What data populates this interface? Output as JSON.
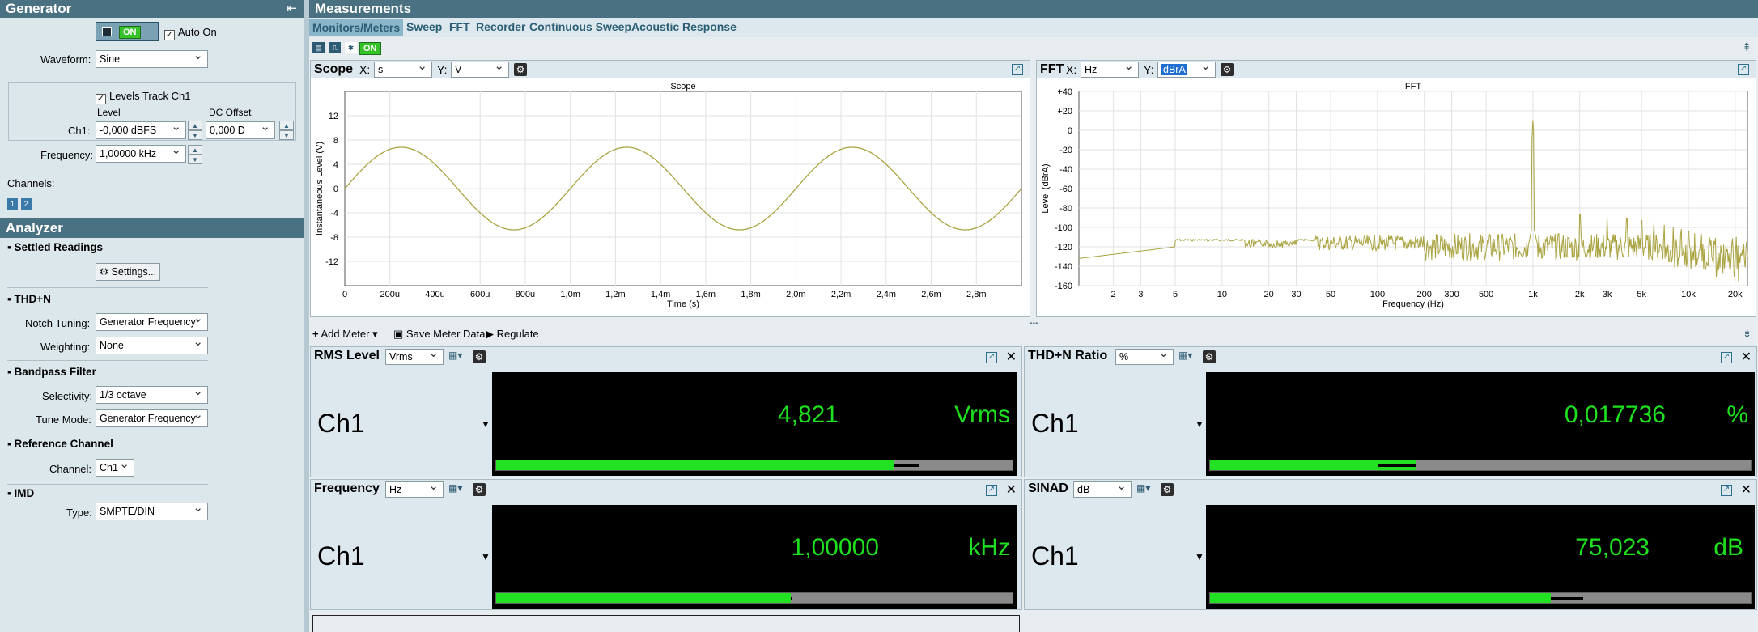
{
  "generator": {
    "title": "Generator",
    "toggle": "ON",
    "auto_on": "Auto On",
    "waveform_label": "Waveform:",
    "waveform": "Sine",
    "levels_track": "Levels Track Ch1",
    "level_col": "Level",
    "dc_col": "DC Offset",
    "ch1_label": "Ch1:",
    "level_value": "-0,000 dBFS",
    "dc_value": "0,000 D",
    "frequency_label": "Frequency:",
    "frequency_value": "1,00000 kHz",
    "channels_label": "Channels:",
    "ch_buttons": [
      "1",
      "2"
    ]
  },
  "analyzer": {
    "title": "Analyzer",
    "settled": "Settled Readings",
    "settings_btn": "Settings...",
    "thdn": "THD+N",
    "notch_label": "Notch Tuning:",
    "notch_value": "Generator Frequency",
    "weight_label": "Weighting:",
    "weight_value": "None",
    "bandpass": "Bandpass Filter",
    "sel_label": "Selectivity:",
    "sel_value": "1/3 octave",
    "tune_label": "Tune Mode:",
    "tune_value": "Generator Frequency",
    "ref": "Reference Channel",
    "channel_label": "Channel:",
    "channel_value": "Ch1",
    "imd": "IMD",
    "type_label": "Type:",
    "type_value": "SMPTE/DIN"
  },
  "measurements": {
    "title": "Measurements",
    "tabs": [
      "Monitors/Meters",
      "Sweep",
      "FFT",
      "Recorder",
      "Continuous Sweep",
      "Acoustic Response"
    ],
    "toggle": "ON"
  },
  "scope": {
    "title": "Scope",
    "x_label": "X:",
    "x_unit": "s",
    "y_label": "Y:",
    "y_unit": "V",
    "plot_title": "Scope"
  },
  "fft": {
    "title": "FFT",
    "x_label": "X:",
    "x_unit": "Hz",
    "y_label": "Y:",
    "y_unit": "dBrA",
    "plot_title": "FFT"
  },
  "meter_toolbar": {
    "add_meter": "Add Meter",
    "save": "Save Meter Data",
    "regulate": "Regulate"
  },
  "meters": [
    {
      "title": "RMS Level",
      "unit_select": "Vrms",
      "channel": "Ch1",
      "value": "4,821",
      "unit": "Vrms",
      "fraction": 0.77,
      "peak": 0.82
    },
    {
      "title": "THD+N Ratio",
      "unit_select": "%",
      "channel": "Ch1",
      "value": "0,017736",
      "unit": "%",
      "fraction": 0.38,
      "peak": 0.31
    },
    {
      "title": "Frequency",
      "unit_select": "Hz",
      "channel": "Ch1",
      "value": "1,00000",
      "unit": "kHz",
      "fraction": 0.57,
      "peak": 0.57
    },
    {
      "title": "SINAD",
      "unit_select": "dB",
      "channel": "Ch1",
      "value": "75,023",
      "unit": "dB",
      "fraction": 0.63,
      "peak": 0.69
    }
  ],
  "chart_data": [
    {
      "type": "line",
      "title": "Scope",
      "xlabel": "Time (s)",
      "ylabel": "Instantaneous Level (V)",
      "xlim": [
        0,
        0.003
      ],
      "ylim": [
        -16,
        16
      ],
      "x_ticks": [
        "0",
        "200u",
        "400u",
        "600u",
        "800u",
        "1,0m",
        "1,2m",
        "1,4m",
        "1,6m",
        "1,8m",
        "2,0m",
        "2,2m",
        "2,4m",
        "2,6m",
        "2,8m"
      ],
      "y_ticks": [
        "12",
        "8",
        "4",
        "0",
        "-4",
        "-8",
        "-12"
      ],
      "series": [
        {
          "frequency_hz": 1000,
          "amplitude_v": 6.8
        }
      ],
      "color": "#a9a340",
      "grid": true
    },
    {
      "type": "line",
      "title": "FFT",
      "xlabel": "Frequency (Hz)",
      "ylabel": "Level (dBrA)",
      "x_scale": "log",
      "xlim": [
        1.2,
        24000
      ],
      "ylim": [
        -160,
        40
      ],
      "x_ticks": [
        "2",
        "3",
        "5",
        "10",
        "20",
        "30",
        "50",
        "100",
        "200",
        "300",
        "500",
        "1k",
        "2k",
        "3k",
        "5k",
        "10k",
        "20k"
      ],
      "y_ticks": [
        "+40",
        "+20",
        "0",
        "-20",
        "-40",
        "-60",
        "-80",
        "-100",
        "-120",
        "-140",
        "-160"
      ],
      "peak": {
        "x": 1000,
        "y": 14
      },
      "noise_floor": -120,
      "color": "#a9a340",
      "grid": true
    }
  ]
}
